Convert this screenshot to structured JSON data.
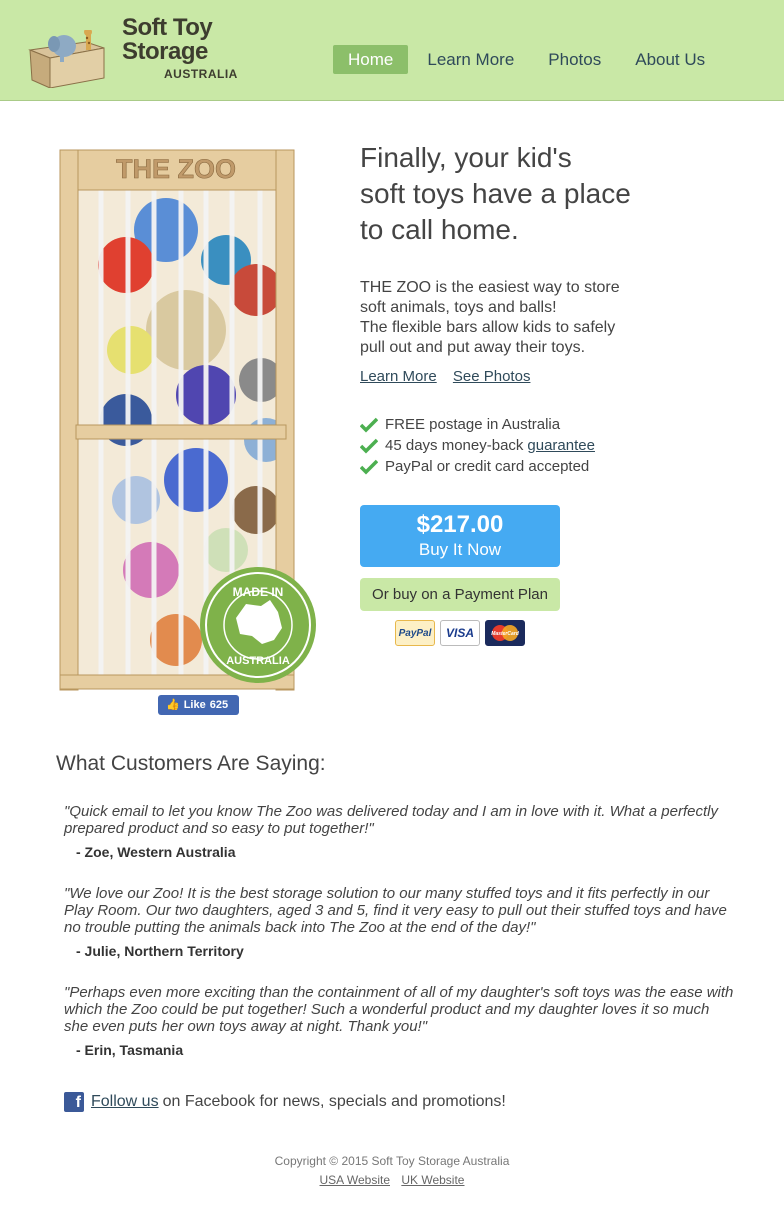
{
  "logo": {
    "line1": "Soft Toy",
    "line2": "Storage",
    "line3": "AUSTRALIA"
  },
  "nav": {
    "items": [
      "Home",
      "Learn More",
      "Photos",
      "About Us"
    ],
    "active_index": 0
  },
  "product": {
    "sign_text": "THE ZOO",
    "badge_text_top": "MADE IN",
    "badge_text_bottom": "AUSTRALIA",
    "fb_like_label": "Like",
    "fb_like_count": "625"
  },
  "headline": {
    "line1": "Finally, your kid's",
    "line2": "soft toys have a place",
    "line3": "to call home."
  },
  "description": {
    "line1": "THE ZOO is the easiest way to store",
    "line2": "soft animals, toys and balls!",
    "line3": "The flexible bars allow kids to safely",
    "line4": "pull out and put away their toys."
  },
  "links": {
    "learn_more": "Learn More",
    "see_photos": "See Photos"
  },
  "features": {
    "item1": "FREE postage in Australia",
    "item2_text": "45 days money-back",
    "item2_link": "guarantee",
    "item3": "PayPal or credit card accepted"
  },
  "buy": {
    "price": "$217.00",
    "label": "Buy It Now",
    "plan_label": "Or buy on a Payment Plan"
  },
  "payment_cards": {
    "paypal": "PayPal",
    "visa": "VISA",
    "mastercard": "MasterCard"
  },
  "testimonials": {
    "heading": "What Customers Are Saying:",
    "items": [
      {
        "quote": "\"Quick email to let you know The Zoo was delivered today and I am in love with it. What a perfectly prepared product and so easy to put together!\"",
        "author": "- Zoe, Western Australia"
      },
      {
        "quote": "\"We love our Zoo! It is the best storage solution to our many stuffed toys and it fits perfectly in our Play Room. Our two daughters, aged 3 and 5, find it very easy to pull out their stuffed toys and have no trouble putting the animals back into The Zoo at the end of the day!\"",
        "author": "- Julie, Northern Territory"
      },
      {
        "quote": "\"Perhaps even more exciting than the containment of all of my daughter's soft toys was the ease with which the Zoo could be put together! Such a wonderful product and my daughter loves it so much she even puts her own toys away at night. Thank you!\"",
        "author": "- Erin, Tasmania"
      }
    ]
  },
  "follow": {
    "link": "Follow us",
    "text": "on Facebook for news, specials and promotions!"
  },
  "footer": {
    "copyright": "Copyright © 2015 Soft Toy Storage Australia",
    "usa": "USA Website",
    "uk": "UK Website"
  },
  "colors": {
    "header_bg": "#c9e8a6",
    "nav_active": "#8cbf6a",
    "buy_button": "#45aaf2",
    "check_green": "#4caf50"
  }
}
